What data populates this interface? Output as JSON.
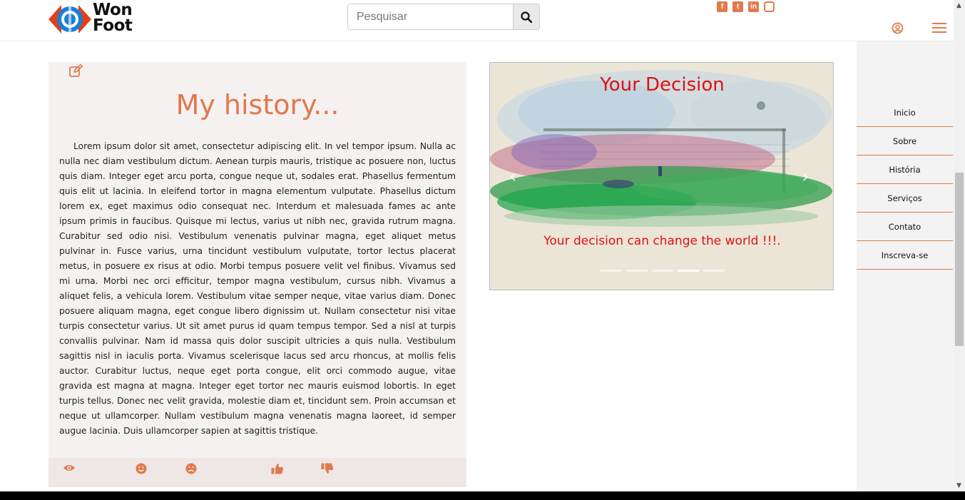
{
  "brand": {
    "logo_text": "Won\nFoot",
    "accent_color": "#e2774d"
  },
  "search": {
    "placeholder": "Pesquisar",
    "icon": "search-icon"
  },
  "social": {
    "facebook": "f",
    "twitter": "t",
    "linkedin": "in",
    "instagram": ""
  },
  "article": {
    "title": "My history...",
    "body": "Lorem ipsum dolor sit amet, consectetur adipiscing elit. In vel tempor ipsum. Nulla ac nulla nec diam vestibulum dictum. Aenean turpis mauris, tristique ac posuere non, luctus quis diam. Integer eget arcu porta, congue neque ut, sodales erat. Phasellus fermentum quis elit ut lacinia. In eleifend tortor in magna elementum vulputate. Phasellus dictum lorem ex, eget maximus odio consequat nec. Interdum et malesuada fames ac ante ipsum primis in faucibus. Quisque mi lectus, varius ut nibh nec, gravida rutrum magna. Curabitur sed odio nisi. Vestibulum venenatis pulvinar magna, eget aliquet metus pulvinar in. Fusce varius, urna tincidunt vestibulum vulputate, tortor lectus placerat metus, in posuere ex risus at odio. Morbi tempus posuere velit vel finibus. Vivamus sed mi urna. Morbi nec orci efficitur, tempor magna vestibulum, cursus nibh. Vivamus a aliquet felis, a vehicula lorem. Vestibulum vitae semper neque, vitae varius diam. Donec posuere aliquam magna, eget congue libero dignissim ut. Nullam consectetur nisi vitae turpis consectetur varius. Ut sit amet purus id quam tempus tempor. Sed a nisl at turpis convallis pulvinar. Nam id massa quis dolor suscipit ultricies a quis nulla. Vestibulum sagittis nisl in iaculis porta. Vivamus scelerisque lacus sed arcu rhoncus, at mollis felis auctor. Curabitur luctus, neque eget porta congue, elit orci commodo augue, vitae gravida est magna at magna. Integer eget tortor nec mauris euismod lobortis. In eget turpis tellus. Donec nec velit gravida, molestie diam et, tincidunt sem. Proin accumsan et neque ut ullamcorper. Nullam vestibulum magna venenatis magna laoreet, id semper augue lacinia. Duis ullamcorper sapien at sagittis tristique.",
    "footer_icons": [
      "eye-icon",
      "smile-icon",
      "frown-icon",
      "thumbs-up-icon",
      "thumbs-down-icon"
    ]
  },
  "carousel": {
    "title": "Your Decision",
    "caption": "Your decision can change the world !!!.",
    "prev": "‹",
    "next": "›",
    "slides": 5,
    "active_slide": 4,
    "title_color": "#e01010"
  },
  "sidebar": {
    "items": [
      {
        "label": "Inicio"
      },
      {
        "label": "Sobre"
      },
      {
        "label": "História"
      },
      {
        "label": "Serviços"
      },
      {
        "label": "Contato"
      },
      {
        "label": "Inscreva-se"
      }
    ]
  }
}
